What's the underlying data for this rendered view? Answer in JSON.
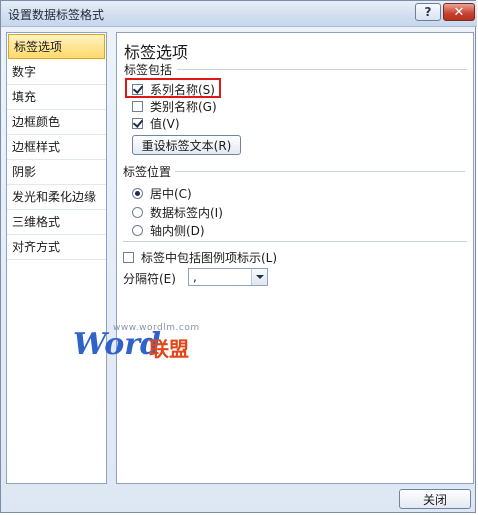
{
  "window": {
    "title": "设置数据标签格式"
  },
  "titlebar": {
    "help_label": "?",
    "close_label": "✕"
  },
  "sidebar": {
    "items": [
      {
        "label": "标签选项"
      },
      {
        "label": "数字"
      },
      {
        "label": "填充"
      },
      {
        "label": "边框颜色"
      },
      {
        "label": "边框样式"
      },
      {
        "label": "阴影"
      },
      {
        "label": "发光和柔化边缘"
      },
      {
        "label": "三维格式"
      },
      {
        "label": "对齐方式"
      }
    ],
    "active_index": 0
  },
  "panel": {
    "title": "标签选项",
    "label_contains": {
      "heading": "标签包括",
      "options": [
        {
          "label": "系列名称(S)",
          "checked": true
        },
        {
          "label": "类别名称(G)",
          "checked": false
        },
        {
          "label": "值(V)",
          "checked": true
        }
      ],
      "reset_button": "重设标签文本(R)"
    },
    "label_position": {
      "heading": "标签位置",
      "options": [
        {
          "label": "居中(C)",
          "selected": true
        },
        {
          "label": "数据标签内(I)",
          "selected": false
        },
        {
          "label": "轴内侧(D)",
          "selected": false
        }
      ]
    },
    "legend_key": {
      "label": "标签中包括图例项标示(L)",
      "checked": false
    },
    "separator": {
      "label": "分隔符(E)",
      "value": ","
    }
  },
  "watermark": {
    "url": "www.wordlm.com",
    "word": "Word",
    "cn": "联盟"
  },
  "footer": {
    "close_button": "关闭"
  },
  "colors": {
    "highlight": "#e01818",
    "active_item": "#ffd96a",
    "accent": "#2f63c8"
  }
}
